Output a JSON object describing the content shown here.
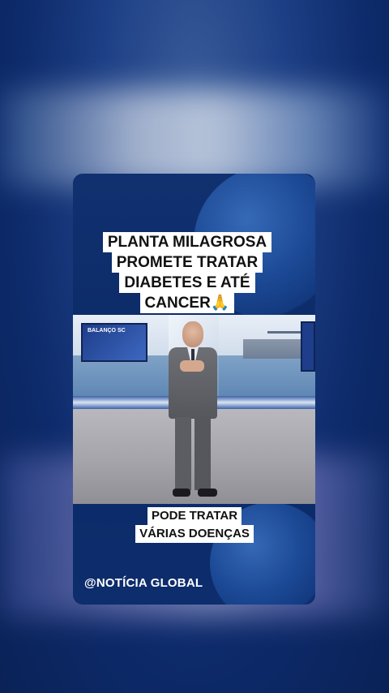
{
  "headline": {
    "lines": [
      "PLANTA MILAGROSA",
      "PROMETE TRATAR",
      "DIABETES E ATÉ",
      "CANCER🙏"
    ]
  },
  "studio": {
    "screen_label": "BALANÇO SC"
  },
  "subcaption": {
    "lines": [
      "PODE TRATAR",
      "VÁRIAS DOENÇAS"
    ]
  },
  "handle": "@NOTÍCIA GLOBAL"
}
